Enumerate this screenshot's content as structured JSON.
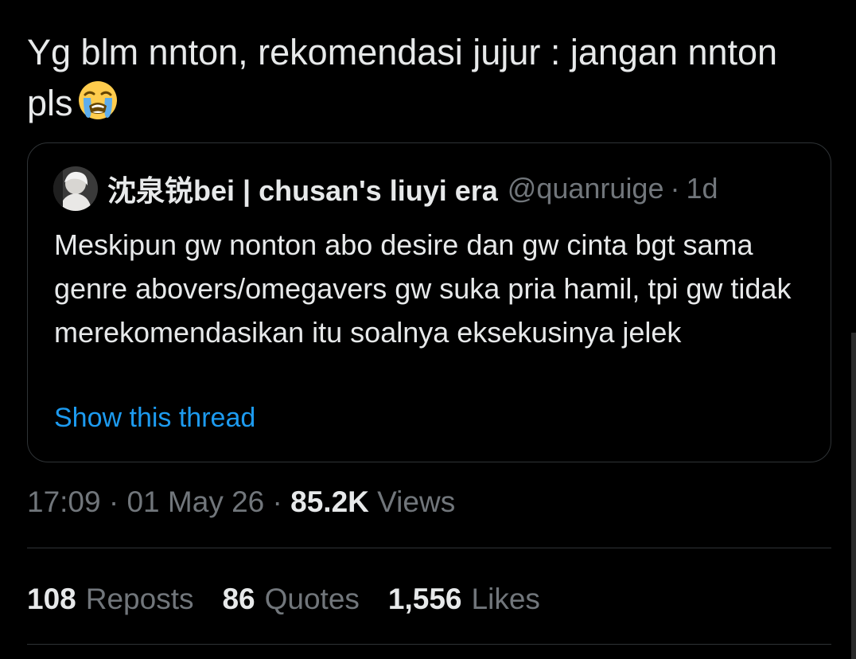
{
  "tweet": {
    "text": "Yg blm nnton, rekomendasi jujur : jangan nnton pls",
    "emoji": "loudly-crying-face-emoji"
  },
  "quote": {
    "display_name": "沈泉锐bei | chusan's liuyi era",
    "handle": "@quanruige",
    "separator": "·",
    "age": "1d",
    "body": "Meskipun gw nonton abo desire dan gw cinta bgt sama genre abovers/omegavers gw suka pria hamil, tpi gw tidak merekomendasikan itu soalnya eksekusinya jelek",
    "show_thread": "Show this thread"
  },
  "meta": {
    "time": "17:09",
    "sep1": "·",
    "date": "01 May 26",
    "sep2": "·",
    "views_count": "85.2K",
    "views_label": "Views"
  },
  "stats": {
    "reposts_count": "108",
    "reposts_label": "Reposts",
    "quotes_count": "86",
    "quotes_label": "Quotes",
    "likes_count": "1,556",
    "likes_label": "Likes"
  },
  "colors": {
    "background": "#000000",
    "text_primary": "#e7e9ea",
    "text_secondary": "#71767b",
    "link": "#1d9bf0",
    "border": "#2f3336"
  }
}
